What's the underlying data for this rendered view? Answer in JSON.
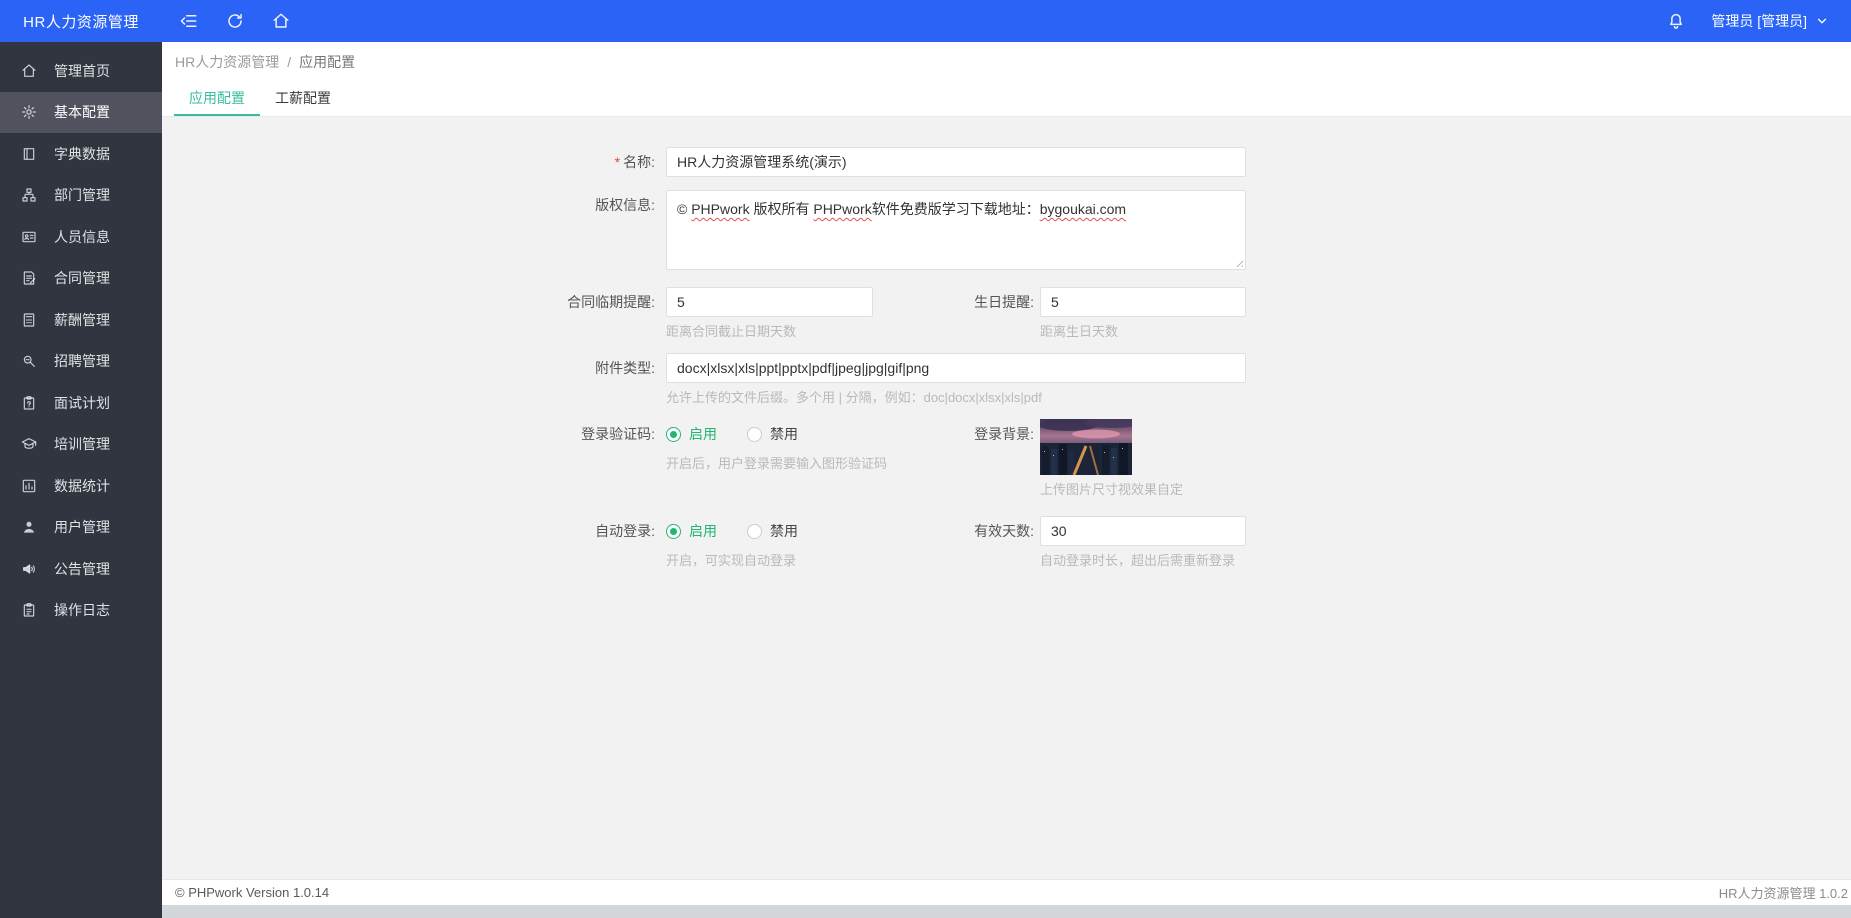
{
  "navbar": {
    "brand": "HR人力资源管理",
    "user": "管理员 [管理员]"
  },
  "sidebar": {
    "items": [
      {
        "label": "管理首页",
        "icon": "home-icon",
        "active": false
      },
      {
        "label": "基本配置",
        "icon": "gear-icon",
        "active": true
      },
      {
        "label": "字典数据",
        "icon": "book-icon",
        "active": false
      },
      {
        "label": "部门管理",
        "icon": "sitemap-icon",
        "active": false
      },
      {
        "label": "人员信息",
        "icon": "id-card-icon",
        "active": false
      },
      {
        "label": "合同管理",
        "icon": "contract-icon",
        "active": false
      },
      {
        "label": "薪酬管理",
        "icon": "calculator-icon",
        "active": false
      },
      {
        "label": "招聘管理",
        "icon": "recruit-search-icon",
        "active": false
      },
      {
        "label": "面试计划",
        "icon": "clipboard-icon",
        "active": false
      },
      {
        "label": "培训管理",
        "icon": "graduation-cap-icon",
        "active": false
      },
      {
        "label": "数据统计",
        "icon": "chart-icon",
        "active": false
      },
      {
        "label": "用户管理",
        "icon": "user-icon",
        "active": false
      },
      {
        "label": "公告管理",
        "icon": "megaphone-icon",
        "active": false
      },
      {
        "label": "操作日志",
        "icon": "log-icon",
        "active": false
      }
    ]
  },
  "breadcrumb": {
    "root": "HR人力资源管理",
    "separator": "/",
    "current": "应用配置"
  },
  "tabs": [
    {
      "label": "应用配置",
      "active": true
    },
    {
      "label": "工薪配置",
      "active": false
    }
  ],
  "form": {
    "name": {
      "label": "名称:",
      "required_mark": "*",
      "value": "HR人力资源管理系统(演示)"
    },
    "copyright": {
      "label": "版权信息:",
      "segments": [
        {
          "text": "© ",
          "misspelled": false
        },
        {
          "text": "PHPwork",
          "misspelled": true
        },
        {
          "text": " 版权所有 ",
          "misspelled": false
        },
        {
          "text": "PHPwork",
          "misspelled": true
        },
        {
          "text": "软件免费版学习下载地址：",
          "misspelled": false
        },
        {
          "text": "bygoukai.com",
          "misspelled": true
        }
      ]
    },
    "contract_reminder": {
      "label": "合同临期提醒:",
      "value": "5",
      "hint": "距离合同截止日期天数"
    },
    "birthday_reminder": {
      "label": "生日提醒:",
      "value": "5",
      "hint": "距离生日天数"
    },
    "attachment_types": {
      "label": "附件类型:",
      "value": "docx|xlsx|xls|ppt|pptx|pdf|jpeg|jpg|gif|png",
      "hint": "允许上传的文件后缀。多个用 | 分隔，例如：doc|docx|xlsx|xls|pdf"
    },
    "captcha": {
      "label": "登录验证码:",
      "options": [
        "启用",
        "禁用"
      ],
      "selected": "启用",
      "hint": "开启后，用户登录需要输入图形验证码"
    },
    "login_bg": {
      "label": "登录背景:",
      "hint": "上传图片尺寸视效果自定"
    },
    "auto_login": {
      "label": "自动登录:",
      "options": [
        "启用",
        "禁用"
      ],
      "selected": "启用",
      "hint": "开启，可实现自动登录"
    },
    "valid_days": {
      "label": "有效天数:",
      "value": "30",
      "hint": "自动登录时长，超出后需重新登录"
    }
  },
  "footer": {
    "left": "© PHPwork Version 1.0.14",
    "right": "HR人力资源管理 1.0.2"
  },
  "colors": {
    "navbar_blue": "#2a63f6",
    "sidebar_bg": "#313540",
    "sidebar_active": "#50535e",
    "tab_accent_teal": "#35bda0",
    "radio_green": "#22b573",
    "hint_gray": "#b9b9b9"
  }
}
